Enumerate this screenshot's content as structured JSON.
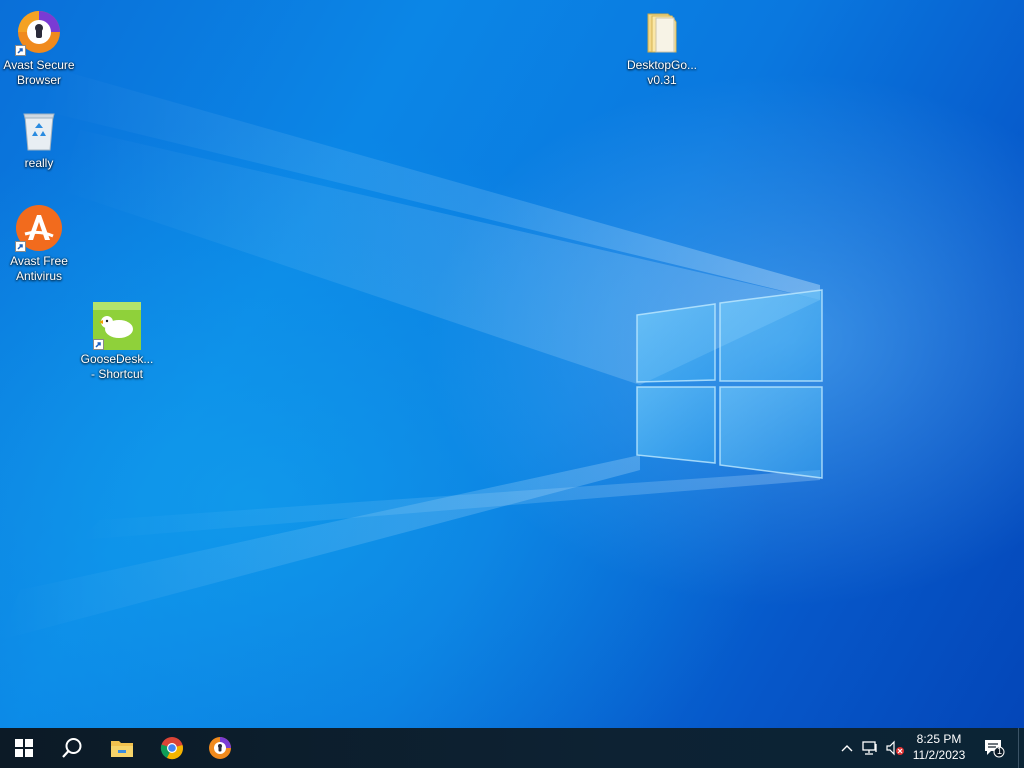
{
  "desktop": {
    "icons": [
      {
        "label": "Avast Secure\nBrowser",
        "icon": "avast-secure-browser-icon",
        "shortcut": true
      },
      {
        "label": "really",
        "icon": "recycle-bin-icon",
        "shortcut": false
      },
      {
        "label": "Avast Free\nAntivirus",
        "icon": "avast-antivirus-icon",
        "shortcut": true
      },
      {
        "label": "GooseDesk...\n- Shortcut",
        "icon": "goose-desktop-icon",
        "shortcut": true
      },
      {
        "label": "DesktopGo...\nv0.31",
        "icon": "folder-icon",
        "shortcut": false
      }
    ]
  },
  "taskbar": {
    "start": {
      "icon": "windows-start-icon"
    },
    "search": {
      "icon": "search-icon"
    },
    "pinned": [
      {
        "name": "File Explorer",
        "icon": "file-explorer-icon"
      },
      {
        "name": "Google Chrome",
        "icon": "chrome-icon"
      },
      {
        "name": "Avast Secure Browser",
        "icon": "avast-secure-browser-icon"
      }
    ],
    "tray": {
      "chevron": "chevron-up-icon",
      "network": "network-icon",
      "volume": "volume-muted-icon",
      "time": "8:25 PM",
      "date": "11/2/2023",
      "notifications_count": "1",
      "notifications_icon": "notification-center-icon"
    }
  },
  "colors": {
    "taskbar_bg": "#0c1a26",
    "desktop_blue": "#0a78df",
    "avast_orange": "#f26b1d",
    "avast_purple": "#6a35c8"
  }
}
